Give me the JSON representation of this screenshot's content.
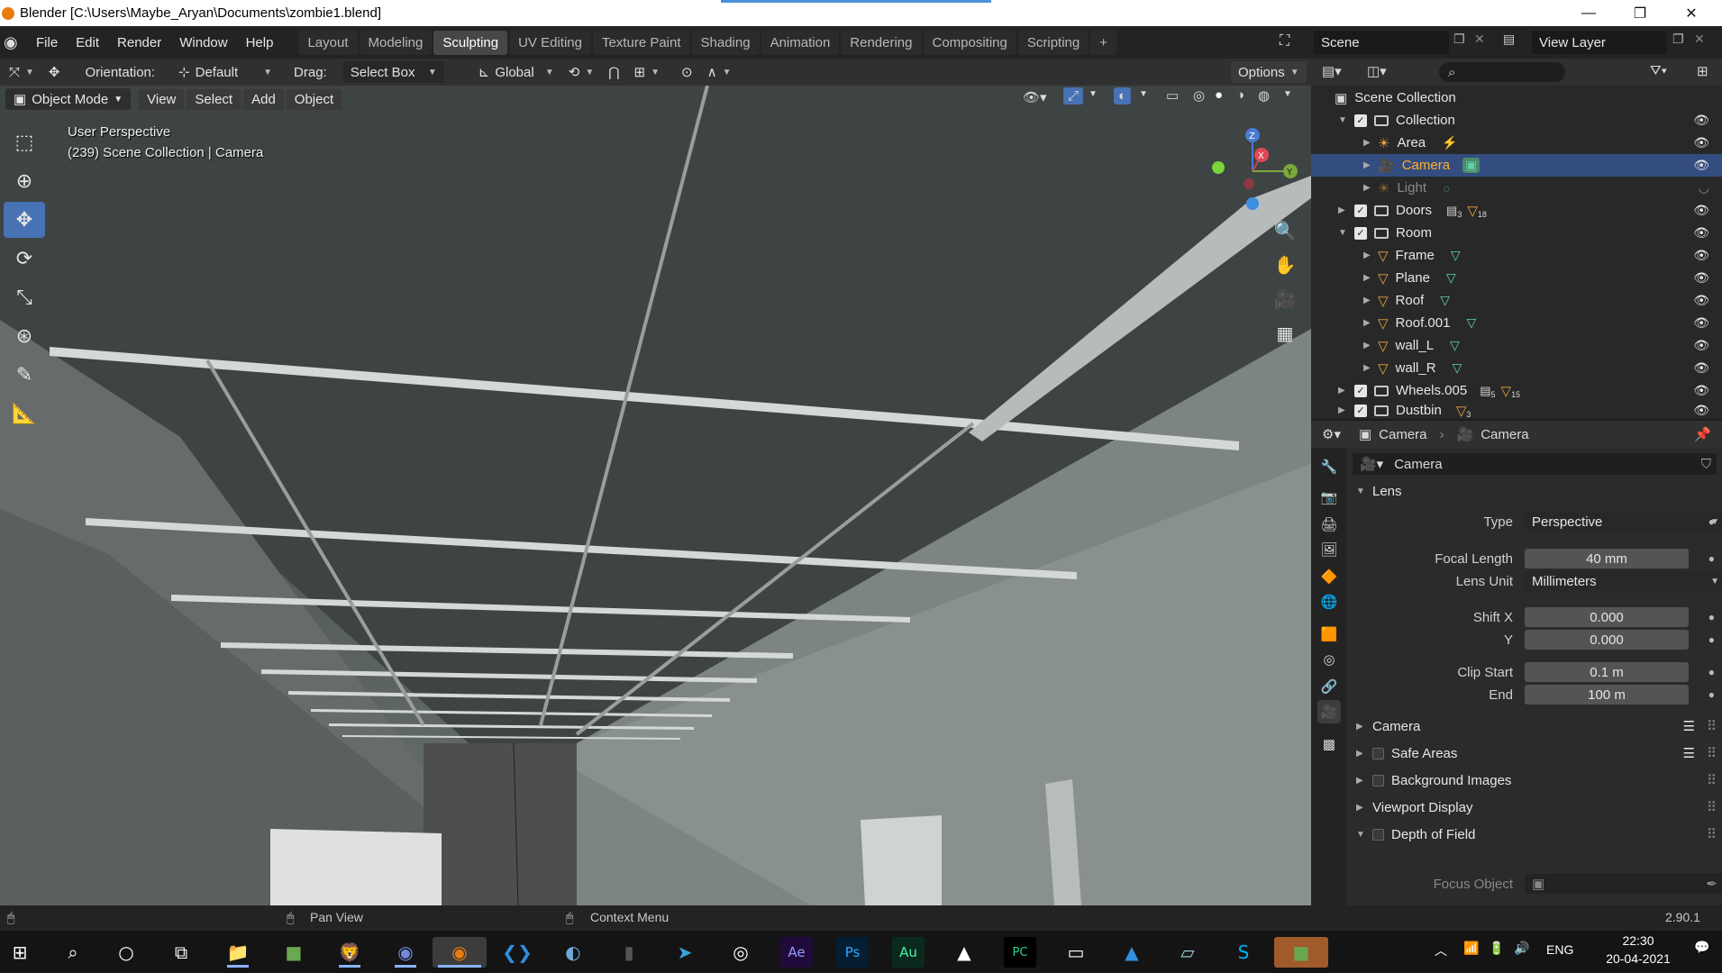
{
  "window": {
    "title": "Blender [C:\\Users\\Maybe_Aryan\\Documents\\zombie1.blend]",
    "controls": [
      "—",
      "❐",
      "✕"
    ]
  },
  "menu": [
    "File",
    "Edit",
    "Render",
    "Window",
    "Help"
  ],
  "workspaces": {
    "tabs": [
      "Layout",
      "Modeling",
      "Sculpting",
      "UV Editing",
      "Texture Paint",
      "Shading",
      "Animation",
      "Rendering",
      "Compositing",
      "Scripting"
    ],
    "active": "Sculpting",
    "add_label": "+"
  },
  "scene": {
    "name": "Scene",
    "view_layer": "View Layer"
  },
  "toolheader": {
    "orientation_label": "Orientation:",
    "orientation_value": "Default",
    "drag_label": "Drag:",
    "drag_value": "Select Box",
    "transform_space": "Global",
    "options_label": "Options"
  },
  "viewheader": {
    "mode": "Object Mode",
    "buttons": [
      "View",
      "Select",
      "Add",
      "Object"
    ]
  },
  "viewport": {
    "perspective": "User Perspective",
    "context": "(239) Scene Collection | Camera",
    "gizmo_axes": {
      "x": "X",
      "y": "Y",
      "z": "Z"
    }
  },
  "outliner": {
    "search_placeholder": "",
    "root": "Scene Collection",
    "items": [
      {
        "name": "Collection",
        "kind": "collection"
      },
      {
        "name": "Area",
        "kind": "light"
      },
      {
        "name": "Camera",
        "kind": "camera",
        "selected": true
      },
      {
        "name": "Light",
        "kind": "light",
        "hidden": true
      },
      {
        "name": "Doors",
        "kind": "collection",
        "badge1": "3",
        "badge2": "18"
      },
      {
        "name": "Room",
        "kind": "collection"
      },
      {
        "name": "Frame",
        "kind": "mesh"
      },
      {
        "name": "Plane",
        "kind": "mesh"
      },
      {
        "name": "Roof",
        "kind": "mesh"
      },
      {
        "name": "Roof.001",
        "kind": "mesh"
      },
      {
        "name": "wall_L",
        "kind": "mesh"
      },
      {
        "name": "wall_R",
        "kind": "mesh"
      },
      {
        "name": "Wheels.005",
        "kind": "collection",
        "badge1": "5",
        "badge2": "15"
      },
      {
        "name": "Dustbin",
        "kind": "collection",
        "badge2": "3"
      }
    ]
  },
  "properties": {
    "breadcrumb_object": "Camera",
    "breadcrumb_data": "Camera",
    "datablock_name": "Camera",
    "lens_panel": "Lens",
    "type_label": "Type",
    "type_value": "Perspective",
    "focal_label": "Focal Length",
    "focal_value": "40 mm",
    "lens_unit_label": "Lens Unit",
    "lens_unit_value": "Millimeters",
    "shift_x_label": "Shift X",
    "shift_x_value": "0.000",
    "shift_y_label": "Y",
    "shift_y_value": "0.000",
    "clip_start_label": "Clip Start",
    "clip_start_value": "0.1 m",
    "clip_end_label": "End",
    "clip_end_value": "100 m",
    "panels": [
      "Camera",
      "Safe Areas",
      "Background Images",
      "Viewport Display",
      "Depth of Field"
    ],
    "focus_object_label": "Focus Object"
  },
  "statusbar": {
    "pan_view": "Pan View",
    "context_menu": "Context Menu",
    "version": "2.90.1"
  },
  "taskbar": {
    "language": "ENG",
    "time": "22:30",
    "date": "20-04-2021",
    "apps": [
      "Explorer",
      "Minecraft",
      "Brave",
      "Discord",
      "Blender",
      "VS Code",
      "Cinema",
      "Mouse",
      "Telegram",
      "OBS",
      "After Effects",
      "Photoshop",
      "Audition",
      "Game",
      "PyCharm",
      "Screen",
      "Photos",
      "Notes",
      "Skype",
      "Minecraft Dungeons"
    ]
  },
  "colors": {
    "selection": "#334d80",
    "active_tool": "#4772b3",
    "mesh_icon": "#e8a33d",
    "data_icon": "#5fd3a3",
    "blender_orange": "#e87d0d"
  }
}
